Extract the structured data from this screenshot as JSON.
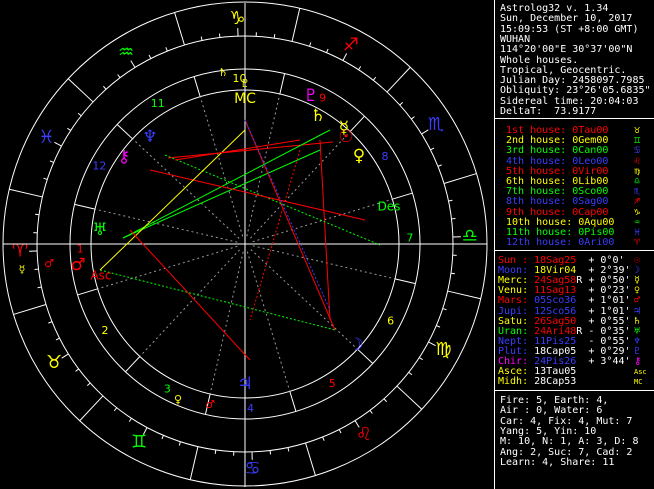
{
  "colors": {
    "fire": "#ff0000",
    "earth": "#ffff00",
    "air": "#00ff00",
    "water": "#3c3cff",
    "magenta": "#ff00ff",
    "white": "#ffffff",
    "grey": "#9a9a9a"
  },
  "header": {
    "lines": [
      "Astrolog32 v. 1.34",
      "Sun, December 10, 2017",
      "15:09:53 (ST +8:00 GMT)",
      "WUHAN",
      "114°20'00\"E 30°37'00\"N",
      "Whole houses.",
      "Tropical, Geocentric.",
      "Julian Day: 2458097.7985",
      "Obliquity: 23°26'05.6835\"",
      "Sidereal time: 20:04:03",
      "DeltaT:  73.9177"
    ]
  },
  "houses": [
    {
      "label": "1st house:",
      "value": "0Tau00",
      "color": "#ff0000",
      "sign_icon": "taurus-icon",
      "glyph": "♉",
      "glyph_color": "#ffff00"
    },
    {
      "label": "2nd house:",
      "value": "0Gem00",
      "color": "#ffff00",
      "sign_icon": "gemini-icon",
      "glyph": "♊",
      "glyph_color": "#00ff00"
    },
    {
      "label": "3rd house:",
      "value": "0Can00",
      "color": "#00ff00",
      "sign_icon": "cancer-icon",
      "glyph": "♋",
      "glyph_color": "#3c3cff"
    },
    {
      "label": "4th house:",
      "value": "0Leo00",
      "color": "#3c3cff",
      "sign_icon": "leo-icon",
      "glyph": "♌",
      "glyph_color": "#ff0000"
    },
    {
      "label": "5th house:",
      "value": "0Vir00",
      "color": "#ff0000",
      "sign_icon": "virgo-icon",
      "glyph": "♍",
      "glyph_color": "#ffff00"
    },
    {
      "label": "6th house:",
      "value": "0Lib00",
      "color": "#ffff00",
      "sign_icon": "libra-icon",
      "glyph": "♎",
      "glyph_color": "#00ff00"
    },
    {
      "label": "7th house:",
      "value": "0Sco00",
      "color": "#00ff00",
      "sign_icon": "scorpio-icon",
      "glyph": "♏",
      "glyph_color": "#3c3cff"
    },
    {
      "label": "8th house:",
      "value": "0Sag00",
      "color": "#3c3cff",
      "sign_icon": "sagittarius-icon",
      "glyph": "♐",
      "glyph_color": "#ff0000"
    },
    {
      "label": "9th house:",
      "value": "0Cap00",
      "color": "#ff0000",
      "sign_icon": "capricorn-icon",
      "glyph": "♑",
      "glyph_color": "#ffff00"
    },
    {
      "label": "10th house:",
      "value": "0Aqu00",
      "color": "#ffff00",
      "sign_icon": "aquarius-icon",
      "glyph": "♒",
      "glyph_color": "#00ff00"
    },
    {
      "label": "11th house:",
      "value": "0Pis00",
      "color": "#00ff00",
      "sign_icon": "pisces-icon",
      "glyph": "♓",
      "glyph_color": "#3c3cff"
    },
    {
      "label": "12th house:",
      "value": "0Ari00",
      "color": "#3c3cff",
      "sign_icon": "aries-icon",
      "glyph": "♈",
      "glyph_color": "#ff0000"
    }
  ],
  "planets": [
    {
      "name": "Sun :",
      "pos": "18Sag25",
      "rx": " ",
      "speed": "+ 0°0'",
      "name_color": "#ff0000",
      "pos_color": "#ff0000",
      "icon": "sun-icon",
      "glyph": "☉",
      "glyph_color": "#ff0000"
    },
    {
      "name": "Moon:",
      "pos": "18Vir04",
      "rx": " ",
      "speed": "+ 2°39'",
      "name_color": "#3c3cff",
      "pos_color": "#ffff00",
      "icon": "moon-icon",
      "glyph": "☽",
      "glyph_color": "#3c3cff"
    },
    {
      "name": "Merc:",
      "pos": "24Sag58",
      "rx": "R",
      "speed": "+ 0°50'",
      "name_color": "#ffff00",
      "pos_color": "#ff0000",
      "icon": "mercury-icon",
      "glyph": "☿",
      "glyph_color": "#ffff00"
    },
    {
      "name": "Venu:",
      "pos": "11Sag13",
      "rx": " ",
      "speed": "+ 0°23'",
      "name_color": "#ffff00",
      "pos_color": "#ff0000",
      "icon": "venus-icon",
      "glyph": "♀",
      "glyph_color": "#ffff00"
    },
    {
      "name": "Mars:",
      "pos": "05Sco36",
      "rx": " ",
      "speed": "+ 1°01'",
      "name_color": "#ff0000",
      "pos_color": "#3c3cff",
      "icon": "mars-icon",
      "glyph": "♂",
      "glyph_color": "#ff0000"
    },
    {
      "name": "Jupi:",
      "pos": "12Sco56",
      "rx": " ",
      "speed": "+ 1°01'",
      "name_color": "#3c3cff",
      "pos_color": "#3c3cff",
      "icon": "jupiter-icon",
      "glyph": "♃",
      "glyph_color": "#3c3cff"
    },
    {
      "name": "Satu:",
      "pos": "26Sag50",
      "rx": " ",
      "speed": "+ 0°55'",
      "name_color": "#ffff00",
      "pos_color": "#ff0000",
      "icon": "saturn-icon",
      "glyph": "♄",
      "glyph_color": "#ffff00"
    },
    {
      "name": "Uran:",
      "pos": "24Ari48",
      "rx": "R",
      "speed": "- 0°35'",
      "name_color": "#00ff00",
      "pos_color": "#ff0000",
      "icon": "uranus-icon",
      "glyph": "♅",
      "glyph_color": "#00ff00"
    },
    {
      "name": "Nept:",
      "pos": "11Pis25",
      "rx": " ",
      "speed": "- 0°55'",
      "name_color": "#3c3cff",
      "pos_color": "#3c3cff",
      "icon": "neptune-icon",
      "glyph": "♆",
      "glyph_color": "#3c3cff"
    },
    {
      "name": "Plut:",
      "pos": "18Cap05",
      "rx": " ",
      "speed": "+ 0°29'",
      "name_color": "#3c3cff",
      "pos_color": "#ffffff",
      "icon": "pluto-icon",
      "glyph": "♇",
      "glyph_color": "#3c3cff"
    },
    {
      "name": "Chir:",
      "pos": "24Pis26",
      "rx": " ",
      "speed": "+ 3°44'",
      "name_color": "#ff00ff",
      "pos_color": "#3c3cff",
      "icon": "chiron-icon",
      "glyph": "⚷",
      "glyph_color": "#ff00ff"
    },
    {
      "name": "Asce:",
      "pos": "13Tau05",
      "rx": " ",
      "speed": "",
      "name_color": "#ffff00",
      "pos_color": "#ffffff",
      "icon": "ascendant-icon",
      "glyph": "Asc",
      "glyph_color": "#ffff00"
    },
    {
      "name": "Midh:",
      "pos": "28Cap53",
      "rx": " ",
      "speed": "",
      "name_color": "#ffff00",
      "pos_color": "#ffffff",
      "icon": "midheaven-icon",
      "glyph": "MC",
      "glyph_color": "#ffff00"
    }
  ],
  "summary": [
    "Fire: 5, Earth: 4,",
    "Air : 0, Water: 6",
    "Car: 4, Fix: 4, Mut: 7",
    "Yang: 5, Yin: 10",
    "M: 10, N: 1, A: 3, D: 8",
    "Ang: 2, Suc: 7, Cad: 2",
    "Learn: 4, Share: 11"
  ],
  "wheel": {
    "house_numbers": [
      "1",
      "2",
      "3",
      "4",
      "5",
      "6",
      "7",
      "8",
      "9",
      "10",
      "11",
      "12"
    ],
    "house_number_colors": [
      "#ff0000",
      "#ffff00",
      "#00ff00",
      "#3c3cff",
      "#ff0000",
      "#ffff00",
      "#00ff00",
      "#3c3cff",
      "#ff0000",
      "#ffff00",
      "#00ff00",
      "#3c3cff"
    ],
    "asc_label": "Asc",
    "mc_label": "MC",
    "des_label": "Des",
    "ic_label": "IC"
  }
}
